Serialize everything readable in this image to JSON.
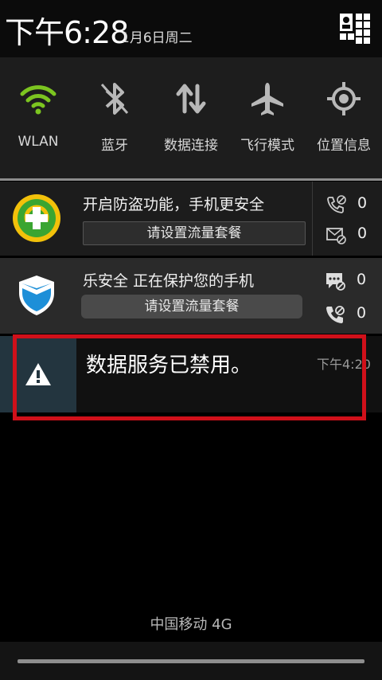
{
  "header": {
    "time": "下午6:28",
    "date": "1月6日周二",
    "settings_icon": "settings-grid-icon"
  },
  "quick_settings": [
    {
      "label": "WLAN",
      "icon": "wifi-icon",
      "active": true
    },
    {
      "label": "蓝牙",
      "icon": "bluetooth-icon",
      "active": false
    },
    {
      "label": "数据连接",
      "icon": "data-sync-icon",
      "active": false
    },
    {
      "label": "飞行模式",
      "icon": "airplane-icon",
      "active": false
    },
    {
      "label": "位置信息",
      "icon": "location-icon",
      "active": false
    }
  ],
  "notifications": [
    {
      "title": "开启防盗功能，手机更安全",
      "button": "请设置流量套餐",
      "app_icon": "360-security-icon",
      "counts": [
        {
          "icon": "blocked-call-icon",
          "value": "0"
        },
        {
          "icon": "blocked-sms-icon",
          "value": "0"
        }
      ]
    },
    {
      "title": "乐安全 正在保护您的手机",
      "button": "请设置流量套餐",
      "app_icon": "shield-app-icon",
      "counts": [
        {
          "icon": "blocked-message-icon",
          "value": "0"
        },
        {
          "icon": "blocked-phone-icon",
          "value": "0"
        }
      ]
    },
    {
      "title": "数据服务已禁用。",
      "time": "下午4:20",
      "app_icon": "warning-icon"
    }
  ],
  "carrier": "中国移动 4G",
  "colors": {
    "wifi_green": "#7cc520",
    "highlight_red": "#d0101a",
    "warning_bg": "#23353f"
  }
}
